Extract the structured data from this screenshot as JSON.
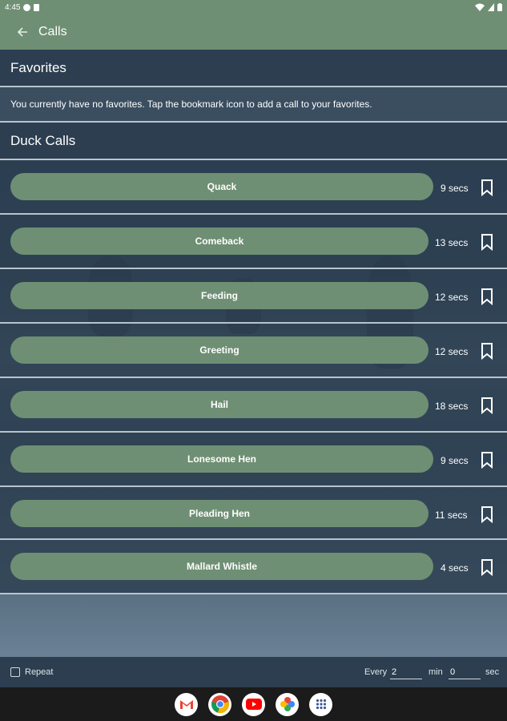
{
  "status_bar": {
    "time": "4:45"
  },
  "app_bar": {
    "title": "Calls"
  },
  "favorites": {
    "header": "Favorites",
    "empty_message": "You currently have no favorites. Tap the bookmark icon to add a call to your favorites."
  },
  "duck_calls": {
    "header": "Duck Calls",
    "items": [
      {
        "label": "Quack",
        "length": "9 secs"
      },
      {
        "label": "Comeback",
        "length": "13 secs"
      },
      {
        "label": "Feeding",
        "length": "12 secs"
      },
      {
        "label": "Greeting",
        "length": "12 secs"
      },
      {
        "label": "Hail",
        "length": "18 secs"
      },
      {
        "label": "Lonesome Hen",
        "length": "9 secs"
      },
      {
        "label": "Pleading Hen",
        "length": "11 secs"
      },
      {
        "label": "Mallard Whistle",
        "length": "4 secs"
      }
    ]
  },
  "repeat": {
    "label": "Repeat",
    "checked": false,
    "every_label": "Every",
    "minutes_value": "2",
    "min_label": "min",
    "seconds_value": "0",
    "sec_label": "sec"
  },
  "dock": {
    "apps": [
      "gmail-icon",
      "chrome-icon",
      "youtube-icon",
      "photos-icon",
      "app-drawer-icon"
    ]
  },
  "colors": {
    "accent": "#6e8f73",
    "background": "#2c3e4f",
    "divider": "#b8c4cc"
  }
}
